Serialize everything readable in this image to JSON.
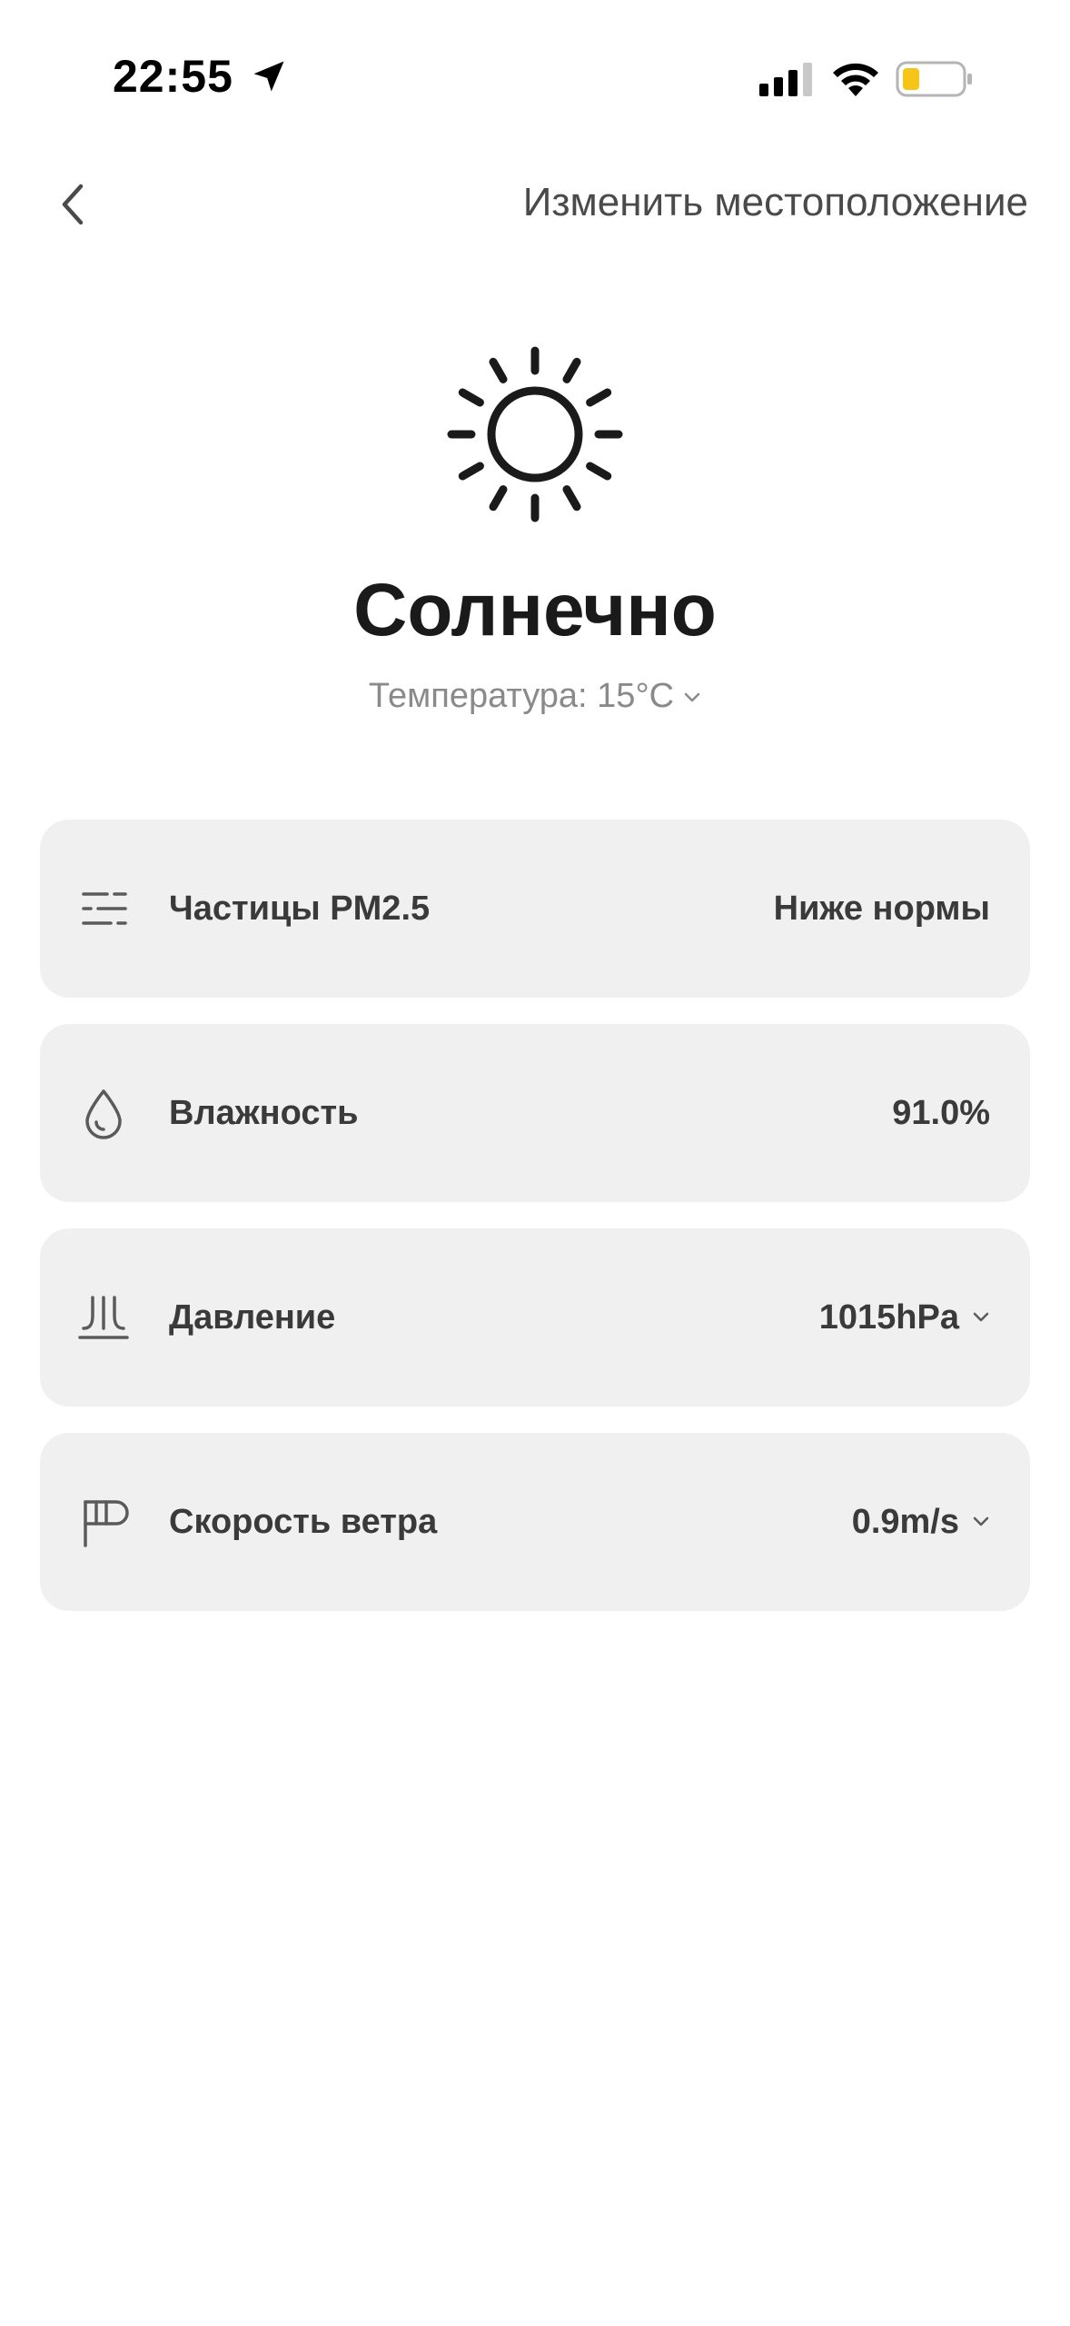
{
  "status_bar": {
    "time": "22:55",
    "battery_color": "#f5c518"
  },
  "header": {
    "change_location_label": "Изменить местоположение"
  },
  "weather": {
    "icon": "sun-icon",
    "condition": "Солнечно",
    "temperature_label": "Температура: 15°C"
  },
  "metrics": [
    {
      "icon": "pm25-icon",
      "label": "Частицы PM2.5",
      "value": "Ниже нормы"
    },
    {
      "icon": "humidity-icon",
      "label": "Влажность",
      "value": "91.0%"
    },
    {
      "icon": "pressure-icon",
      "label": "Давление",
      "value": "1015hPa"
    },
    {
      "icon": "wind-icon",
      "label": "Скорость ветра",
      "value": "0.9m/s"
    }
  ]
}
